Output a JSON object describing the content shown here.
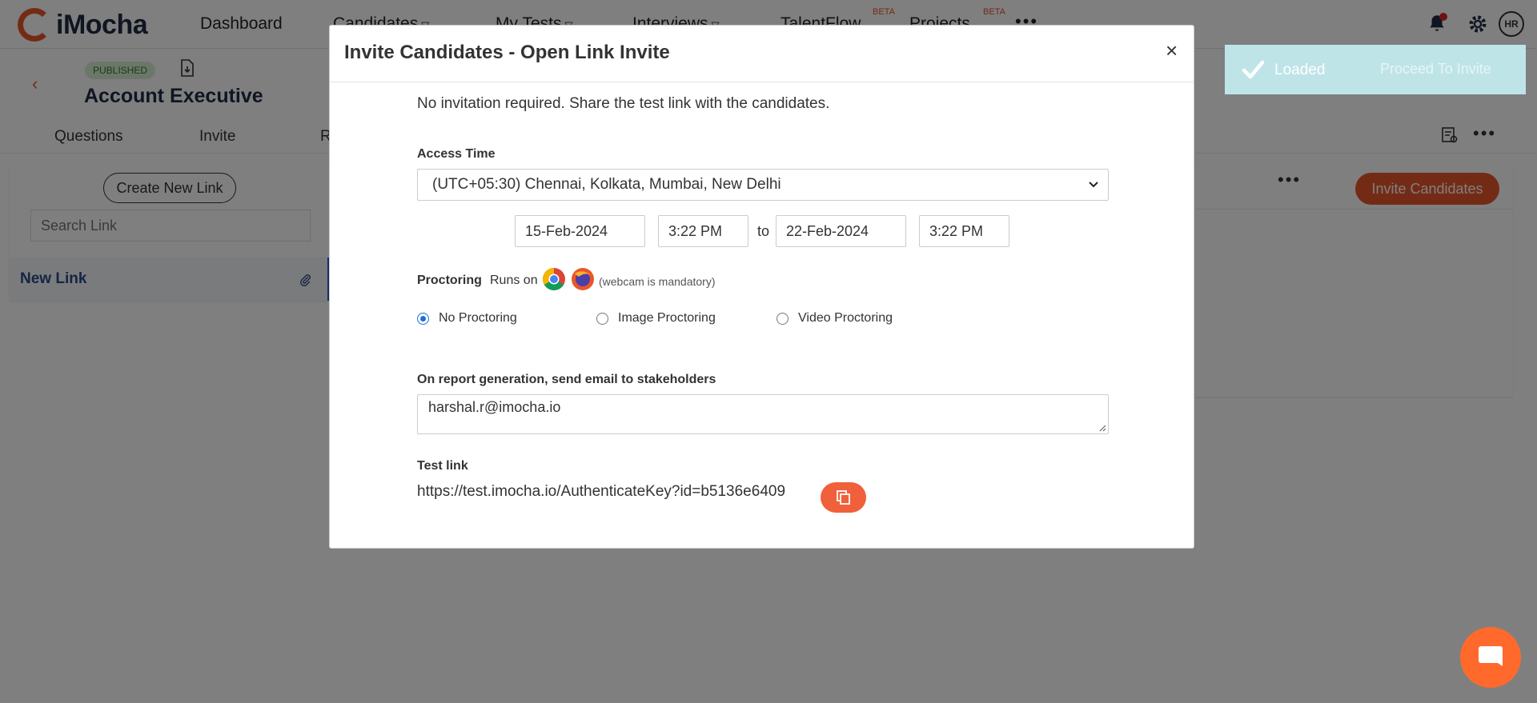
{
  "nav": {
    "brand": "iMocha",
    "items": [
      "Dashboard",
      "Candidates",
      "My Tests",
      "Interviews",
      "TalentFlow",
      "Projects"
    ],
    "beta_label": "BETA",
    "more": "•••",
    "avatar": "HR"
  },
  "subheader": {
    "status": "PUBLISHED",
    "title": "Account Executive",
    "tabs": [
      "Questions",
      "Invite",
      "R"
    ],
    "more": "•••"
  },
  "left": {
    "create_link": "Create New Link",
    "search_placeholder": "Search Link",
    "link_name": "New Link"
  },
  "right": {
    "more": "•••",
    "invite_button": "Invite Candidates"
  },
  "toast": {
    "message": "Loaded",
    "proceed": "Proceed To Invite"
  },
  "modal": {
    "title": "Invite Candidates - Open Link Invite",
    "close": "×",
    "info": "No invitation required. Share the test link with the candidates.",
    "access_time_label": "Access Time",
    "timezone": "(UTC+05:30) Chennai, Kolkata, Mumbai, New Delhi",
    "start_date": "15-Feb-2024",
    "start_time": "3:22 PM",
    "to_label": "to",
    "end_date": "22-Feb-2024",
    "end_time": "3:22 PM",
    "proctoring_label": "Proctoring",
    "runs_on": "Runs on",
    "webcam_note": "(webcam is mandatory)",
    "proctoring_options": [
      "No Proctoring",
      "Image Proctoring",
      "Video Proctoring"
    ],
    "selected_proctoring": "No Proctoring",
    "report_label": "On report generation, send email to stakeholders",
    "stakeholder_email": "harshal.r@imocha.io",
    "test_link_label": "Test link",
    "test_link": "https://test.imocha.io/AuthenticateKey?id=b5136e6409"
  },
  "colors": {
    "accent": "#e8562a",
    "brand_dark": "#202a44",
    "radio_selected": "#1a6fd8",
    "toast_bg": "#bfe4e8"
  }
}
